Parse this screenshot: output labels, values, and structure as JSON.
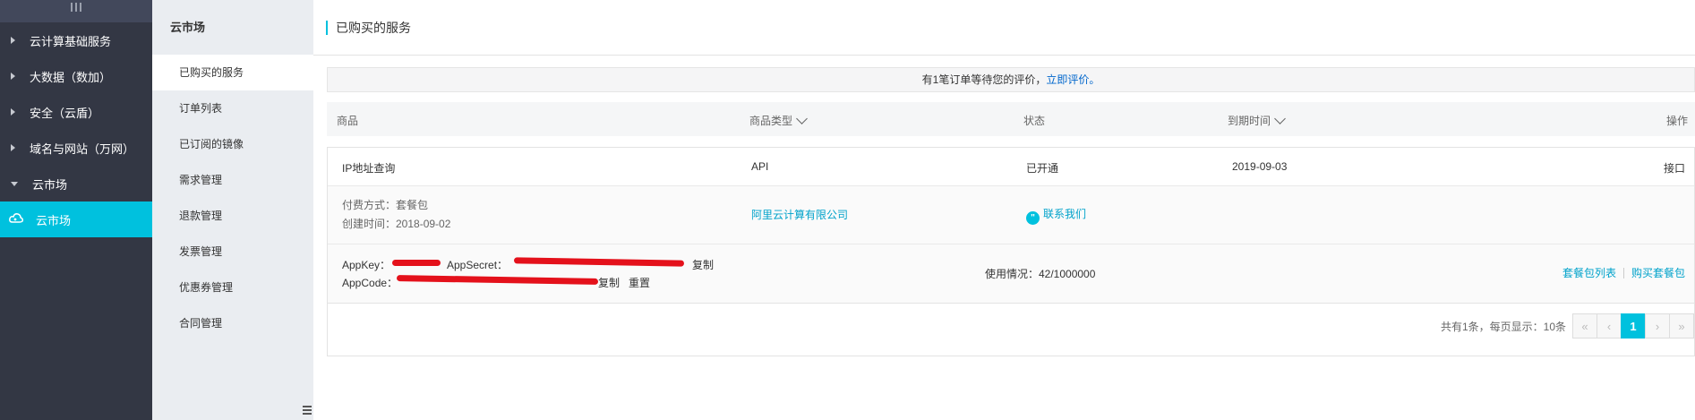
{
  "sidebar": {
    "items": [
      {
        "label": "云计算基础服务"
      },
      {
        "label": "大数据（数加）"
      },
      {
        "label": "安全（云盾）"
      },
      {
        "label": "域名与网站（万网）"
      },
      {
        "label": "云市场"
      },
      {
        "label": "云市场"
      }
    ]
  },
  "submenu": {
    "title": "云市场",
    "items": [
      {
        "label": "已购买的服务"
      },
      {
        "label": "订单列表"
      },
      {
        "label": "已订阅的镜像"
      },
      {
        "label": "需求管理"
      },
      {
        "label": "退款管理"
      },
      {
        "label": "发票管理"
      },
      {
        "label": "优惠券管理"
      },
      {
        "label": "合同管理"
      }
    ]
  },
  "page": {
    "title": "已购买的服务",
    "notice_text": "有1笔订单等待您的评价，",
    "notice_link": "立即评价。"
  },
  "table": {
    "headers": {
      "product": "商品",
      "type": "商品类型",
      "status": "状态",
      "expire": "到期时间",
      "action": "操作"
    },
    "row": {
      "name": "IP地址查询",
      "type": "API",
      "status": "已开通",
      "expire": "2019-09-03",
      "action": "接口",
      "payment": "付费方式：套餐包",
      "created": "创建时间：2018-09-02",
      "vendor": "阿里云计算有限公司",
      "contact": "联系我们",
      "appkey_label": "AppKey：",
      "appsecret_label": "AppSecret：",
      "appcode_label": "AppCode：",
      "copy1": "复制",
      "copy2": "复制",
      "reset": "重置",
      "usage": "使用情况：42/1000000",
      "package_list": "套餐包列表",
      "buy_package": "购买套餐包"
    }
  },
  "pager": {
    "info": "共有1条，每页显示：10条",
    "first": "«",
    "prev": "‹",
    "current": "1",
    "next": "›",
    "last": "»"
  },
  "colors": {
    "accent": "#00c1de",
    "link": "#00a2ca",
    "sidebar_bg": "#333744",
    "submenu_bg": "#eaedf1",
    "redaction": "#e4111b"
  }
}
